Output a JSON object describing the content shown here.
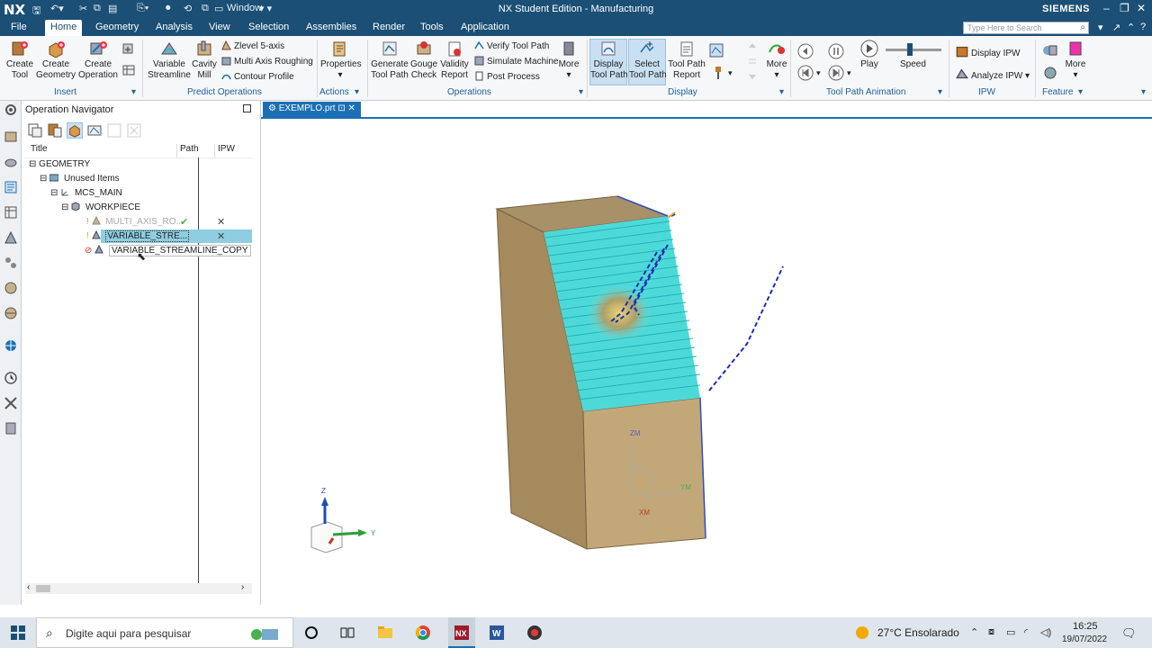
{
  "titlebar": {
    "logo": "NX",
    "window_menu": "Window",
    "title": "NX Student Edition - Manufacturing",
    "brand": "SIEMENS"
  },
  "menubar": {
    "items": [
      "File",
      "Home",
      "Geometry",
      "Analysis",
      "View",
      "Selection",
      "Assemblies",
      "Render",
      "Tools",
      "Application"
    ],
    "search_placeholder": "Type Here to Search"
  },
  "ribbon": {
    "insert": {
      "create_tool": "Create\nTool",
      "create_geometry": "Create\nGeometry",
      "create_operation": "Create\nOperation",
      "group": "Insert"
    },
    "predict": {
      "variable_streamline": "Variable\nStreamline",
      "cavity_mill": "Cavity\nMill",
      "zlevel": "Zlevel 5-axis",
      "multi_axis": "Multi Axis Roughing",
      "contour": "Contour Profile",
      "group": "Predict Operations"
    },
    "actions": {
      "properties": "Properties",
      "group": "Actions"
    },
    "operations": {
      "generate": "Generate\nTool Path",
      "gouge": "Gouge\nCheck",
      "validity": "Validity\nReport",
      "verify": "Verify Tool Path",
      "simulate": "Simulate Machine",
      "post": "Post Process",
      "more": "More",
      "group": "Operations"
    },
    "display": {
      "display_tool_path": "Display\nTool Path",
      "select_tool_path": "Select\nTool Path",
      "tool_path_report": "Tool Path\nReport",
      "more": "More",
      "group": "Display"
    },
    "animation": {
      "play": "Play",
      "speed": "Speed",
      "group": "Tool Path Animation"
    },
    "ipw": {
      "display": "Display IPW",
      "analyze": "Analyze IPW",
      "group": "IPW"
    },
    "feature": {
      "more": "More",
      "group": "Feature"
    }
  },
  "navigator": {
    "title": "Operation Navigator",
    "columns": [
      "Title",
      "Path",
      "IPW"
    ],
    "tree": [
      {
        "label": "GEOMETRY"
      },
      {
        "label": "Unused Items"
      },
      {
        "label": "MCS_MAIN"
      },
      {
        "label": "WORKPIECE"
      },
      {
        "label": "MULTI_AXIS_RO...",
        "path": "✔",
        "ipw": "✕"
      },
      {
        "label": "VARIABLE_STRE...",
        "path": "",
        "ipw": "✕"
      },
      {
        "label": "VARIABLE_STREAMLINE_COPY"
      }
    ]
  },
  "viewport": {
    "tab": "EXEMPLO.prt",
    "tab_pin": "⊡",
    "tab_close": "✕",
    "axis_labels": {
      "zm": "ZM",
      "ym": "YM",
      "xm": "XM",
      "z": "Z",
      "y": "Y"
    }
  },
  "taskbar": {
    "search_text": "Digite aqui para pesquisar",
    "weather": "27°C  Ensolarado",
    "time": "16:25",
    "date": "19/07/2022"
  },
  "colors": {
    "titlebar": "#1b4f75",
    "part": "#c2a878",
    "toolpath": "#29d6d6",
    "accent": "#1b6fb5"
  }
}
